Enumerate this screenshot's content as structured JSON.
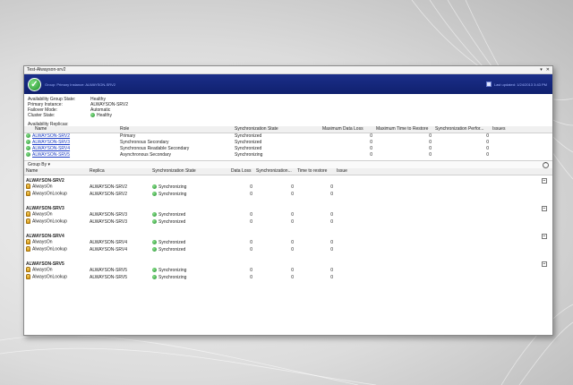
{
  "window": {
    "title": "Test-Alwayson-srv2",
    "controls": [
      "▾",
      "✕"
    ]
  },
  "banner": {
    "title": "Group: Primary Instance: ALWAYSON-SRV2",
    "right_text": "Last updated: 1/24/2013 3:43 PM"
  },
  "summary": [
    {
      "key": "Availability Group State:",
      "value": "Healthy"
    },
    {
      "key": "Primary Instance:",
      "value": "ALWAYSON-SRV2"
    },
    {
      "key": "Failover Mode:",
      "value": "Automatic"
    },
    {
      "key": "Cluster State:",
      "value": "Healthy"
    }
  ],
  "replicas": {
    "label": "Availability Replicas:",
    "columns": [
      "Name",
      "Role",
      "Synchronization State",
      "Maximum Data Loss",
      "Maximum Time to Restore",
      "Synchronization Perfor...",
      "Issues"
    ],
    "rows": [
      {
        "name": "ALWAYSON-SRV2",
        "role": "Primary",
        "state": "Synchronized",
        "loss": "0",
        "restore": "0",
        "perf": "0",
        "issues": ""
      },
      {
        "name": "ALWAYSON-SRV3",
        "role": "Synchronous Secondary",
        "state": "Synchronized",
        "loss": "0",
        "restore": "0",
        "perf": "0",
        "issues": ""
      },
      {
        "name": "ALWAYSON-SRV4",
        "role": "Synchronous Readable Secondary",
        "state": "Synchronized",
        "loss": "0",
        "restore": "0",
        "perf": "0",
        "issues": ""
      },
      {
        "name": "ALWAYSON-SRV5",
        "role": "Asynchronous Secondary",
        "state": "Synchronizing",
        "loss": "0",
        "restore": "0",
        "perf": "0",
        "issues": ""
      }
    ]
  },
  "groupby": {
    "label": "Group By ▾",
    "collapse": "⌃"
  },
  "detail": {
    "columns": [
      "Name",
      "Replica",
      "Synchronization State",
      "Data Loss",
      "Synchronization...",
      "Time to restore",
      "Issue"
    ],
    "groups": [
      {
        "title": "ALWAYSON-SRV2",
        "toggle": "−",
        "rows": [
          {
            "name": "AlwaysOn",
            "replica": "ALWAYSON-SRV2",
            "state": "Synchronizing",
            "loss": "0",
            "sync": "0",
            "restore": "0"
          },
          {
            "name": "AlwaysOnLookup",
            "replica": "ALWAYSON-SRV2",
            "state": "Synchronizing",
            "loss": "0",
            "sync": "0",
            "restore": "0"
          }
        ]
      },
      {
        "title": "ALWAYSON-SRV3",
        "toggle": "−",
        "rows": [
          {
            "name": "AlwaysOn",
            "replica": "ALWAYSON-SRV3",
            "state": "Synchronized",
            "loss": "0",
            "sync": "0",
            "restore": "0"
          },
          {
            "name": "AlwaysOnLookup",
            "replica": "ALWAYSON-SRV3",
            "state": "Synchronized",
            "loss": "0",
            "sync": "0",
            "restore": "0"
          }
        ]
      },
      {
        "title": "ALWAYSON-SRV4",
        "toggle": "−",
        "rows": [
          {
            "name": "AlwaysOn",
            "replica": "ALWAYSON-SRV4",
            "state": "Synchronized",
            "loss": "0",
            "sync": "0",
            "restore": "0"
          },
          {
            "name": "AlwaysOnLookup",
            "replica": "ALWAYSON-SRV4",
            "state": "Synchronized",
            "loss": "0",
            "sync": "0",
            "restore": "0"
          }
        ]
      },
      {
        "title": "ALWAYSON-SRV5",
        "toggle": "−",
        "rows": [
          {
            "name": "AlwaysOn",
            "replica": "ALWAYSON-SRV5",
            "state": "Synchronizing",
            "loss": "0",
            "sync": "0",
            "restore": "0"
          },
          {
            "name": "AlwaysOnLookup",
            "replica": "ALWAYSON-SRV5",
            "state": "Synchronizing",
            "loss": "0",
            "sync": "0",
            "restore": "0"
          }
        ]
      }
    ]
  },
  "icons": {
    "healthy": "check-circle-icon",
    "database": "database-icon",
    "banner": "check-badge-icon"
  },
  "colors": {
    "banner": "#10206e",
    "link": "#1a3cc4",
    "healthy": "#1f8a2d"
  }
}
